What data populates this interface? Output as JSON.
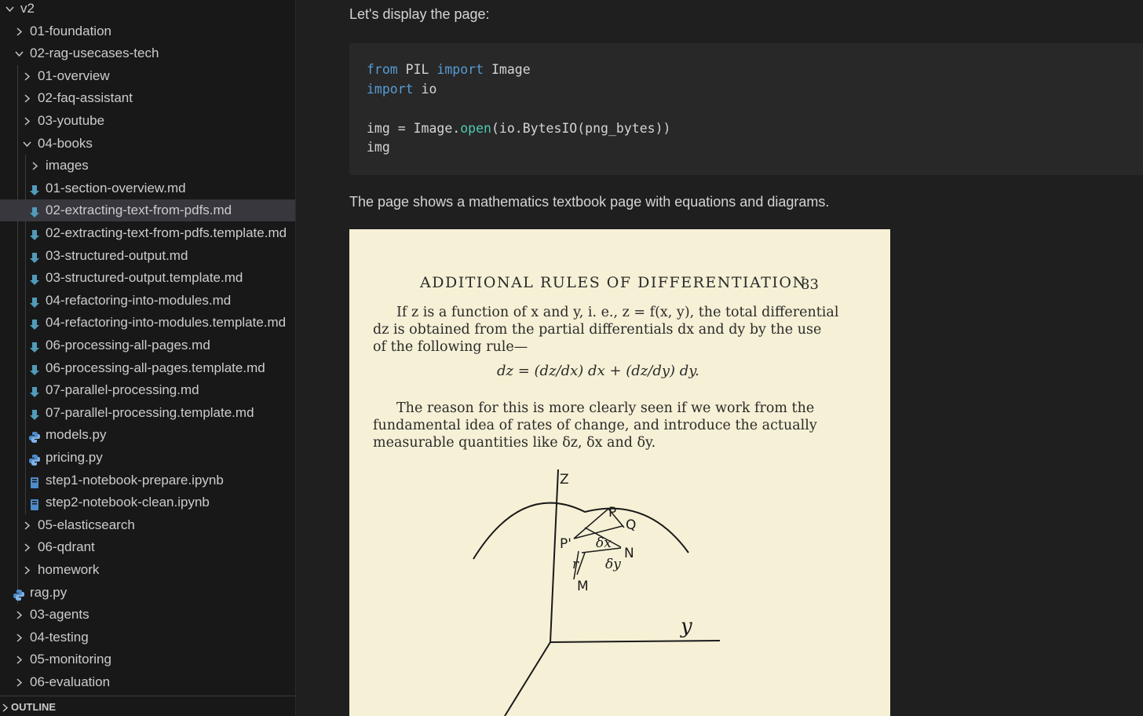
{
  "explorer": {
    "items": [
      {
        "label": "v2",
        "type": "folder",
        "expanded": true
      },
      {
        "label": "01-foundation",
        "type": "folder",
        "expanded": false
      },
      {
        "label": "02-rag-usecases-tech",
        "type": "folder",
        "expanded": true
      },
      {
        "label": "01-overview",
        "type": "folder",
        "expanded": false
      },
      {
        "label": "02-faq-assistant",
        "type": "folder",
        "expanded": false
      },
      {
        "label": "03-youtube",
        "type": "folder",
        "expanded": false
      },
      {
        "label": "04-books",
        "type": "folder",
        "expanded": true
      },
      {
        "label": "images",
        "type": "folder",
        "expanded": false
      },
      {
        "label": "01-section-overview.md",
        "type": "markdown"
      },
      {
        "label": "02-extracting-text-from-pdfs.md",
        "type": "markdown",
        "selected": true
      },
      {
        "label": "02-extracting-text-from-pdfs.template.md",
        "type": "markdown"
      },
      {
        "label": "03-structured-output.md",
        "type": "markdown"
      },
      {
        "label": "03-structured-output.template.md",
        "type": "markdown"
      },
      {
        "label": "04-refactoring-into-modules.md",
        "type": "markdown"
      },
      {
        "label": "04-refactoring-into-modules.template.md",
        "type": "markdown"
      },
      {
        "label": "06-processing-all-pages.md",
        "type": "markdown"
      },
      {
        "label": "06-processing-all-pages.template.md",
        "type": "markdown"
      },
      {
        "label": "07-parallel-processing.md",
        "type": "markdown"
      },
      {
        "label": "07-parallel-processing.template.md",
        "type": "markdown"
      },
      {
        "label": "models.py",
        "type": "python"
      },
      {
        "label": "pricing.py",
        "type": "python"
      },
      {
        "label": "step1-notebook-prepare.ipynb",
        "type": "notebook"
      },
      {
        "label": "step2-notebook-clean.ipynb",
        "type": "notebook"
      },
      {
        "label": "05-elasticsearch",
        "type": "folder",
        "expanded": false
      },
      {
        "label": "06-qdrant",
        "type": "folder",
        "expanded": false
      },
      {
        "label": "homework",
        "type": "folder",
        "expanded": false
      },
      {
        "label": "rag.py",
        "type": "python"
      },
      {
        "label": "03-agents",
        "type": "folder",
        "expanded": false
      },
      {
        "label": "04-testing",
        "type": "folder",
        "expanded": false
      },
      {
        "label": "05-monitoring",
        "type": "folder",
        "expanded": false
      },
      {
        "label": "06-evaluation",
        "type": "folder",
        "expanded": false
      }
    ],
    "outline_label": "OUTLINE"
  },
  "notebook": {
    "intro_text": "Let's display the page:",
    "code": {
      "l1_a": "from",
      "l1_b": " PIL ",
      "l1_c": "import",
      "l1_d": " Image",
      "l2_a": "import",
      "l2_b": " io",
      "l4_a": "img = Image.",
      "l4_b": "open",
      "l4_c": "(io.BytesIO(png_bytes))",
      "l5": "img"
    },
    "description_text": "The page shows a mathematics textbook page with equations and diagrams.",
    "book_page": {
      "header": "ADDITIONAL RULES OF DIFFERENTIATION",
      "page_number": "83",
      "para1_line1": "If z is a function of x and y, i. e., z = f(x, y), the total differential",
      "para1_line2": "dz is obtained from the partial differentials dx and dy by the use",
      "para1_line3": "of the following rule—",
      "equation": "dz = (dz/dx) dx + (dz/dy) dy.",
      "para2_line1": "The reason for this is more clearly seen if we work from the",
      "para2_line2": "fundamental idea of rates of change, and introduce the actually",
      "para2_line3": "measurable quantities like δz, δx and δy.",
      "diagram_labels": {
        "z": "Z",
        "P": "P",
        "Q": "Q",
        "P_prime": "P'",
        "dx": "δx",
        "N": "N",
        "dy": "δy",
        "r": "r",
        "M": "M",
        "y": "y"
      }
    }
  },
  "colors": {
    "sidebar_bg": "#181818",
    "editor_bg": "#1f1f1f",
    "selection_bg": "#37373d",
    "code_bg": "#282828",
    "keyword": "#569cd6",
    "function": "#4ec9b0",
    "markdown_icon": "#519aba",
    "python_icon": "#4d8bc9",
    "page_paper": "#f6f1d6"
  }
}
